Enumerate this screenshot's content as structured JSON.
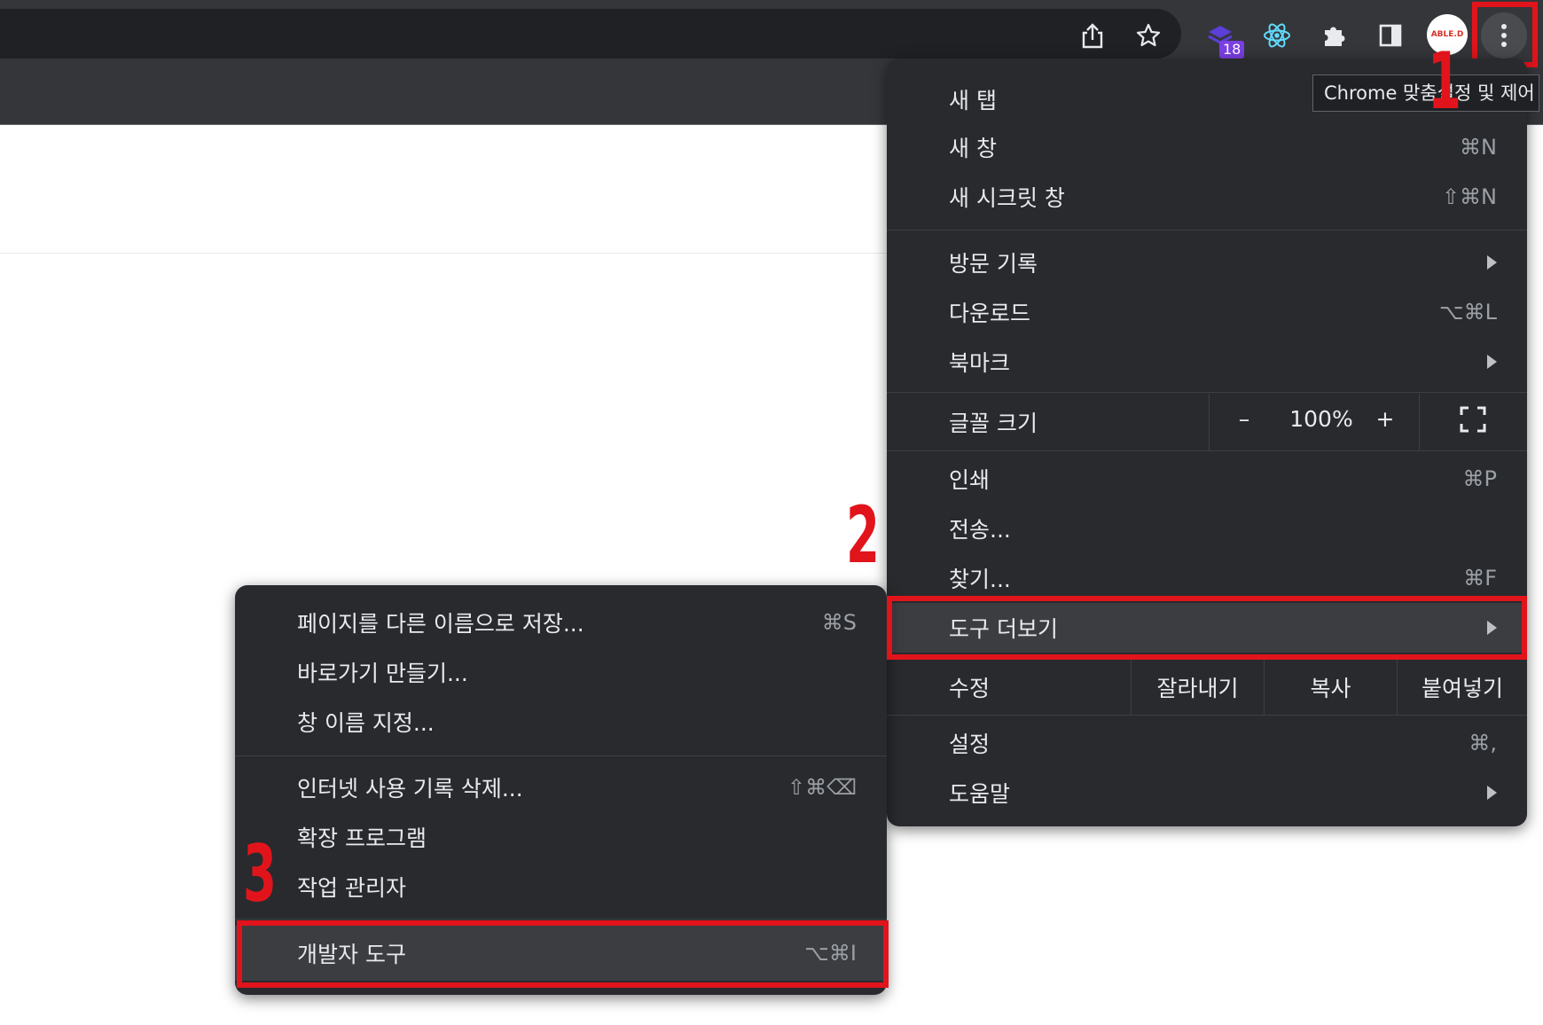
{
  "toolbar": {
    "badge_count": "18",
    "avatar_text": "ABLE.D",
    "tooltip": "Chrome 맞춤설정 및 제어"
  },
  "main_menu": {
    "items": [
      {
        "label": "새 탭",
        "shortcut": ""
      },
      {
        "label": "새 창",
        "shortcut": "⌘N"
      },
      {
        "label": "새 시크릿 창",
        "shortcut": "⇧⌘N"
      },
      {
        "label": "방문 기록",
        "submenu": true
      },
      {
        "label": "다운로드",
        "shortcut": "⌥⌘L"
      },
      {
        "label": "북마크",
        "submenu": true
      },
      {
        "label": "인쇄",
        "shortcut": "⌘P"
      },
      {
        "label": "전송...",
        "shortcut": ""
      },
      {
        "label": "찾기...",
        "shortcut": "⌘F"
      },
      {
        "label": "도구 더보기",
        "submenu": true
      },
      {
        "label": "설정",
        "shortcut": "⌘,"
      },
      {
        "label": "도움말",
        "submenu": true
      }
    ],
    "zoom": {
      "label": "글꼴 크기",
      "minus": "–",
      "value": "100%",
      "plus": "+"
    },
    "edit": {
      "label": "수정",
      "cut": "잘라내기",
      "copy": "복사",
      "paste": "붙여넣기"
    }
  },
  "sub_menu": {
    "items": [
      {
        "label": "페이지를 다른 이름으로 저장...",
        "shortcut": "⌘S"
      },
      {
        "label": "바로가기 만들기...",
        "shortcut": ""
      },
      {
        "label": "창 이름 지정...",
        "shortcut": ""
      },
      {
        "label": "인터넷 사용 기록 삭제...",
        "shortcut": "⇧⌘⌫"
      },
      {
        "label": "확장 프로그램",
        "shortcut": ""
      },
      {
        "label": "작업 관리자",
        "shortcut": ""
      },
      {
        "label": "개발자 도구",
        "shortcut": "⌥⌘I"
      }
    ]
  },
  "annotations": {
    "step1": "1",
    "step2": "2",
    "step3": "3"
  },
  "colors": {
    "highlight": "#e1141c",
    "menu_bg": "#292a2d",
    "toolbar_bg": "#35363a"
  }
}
